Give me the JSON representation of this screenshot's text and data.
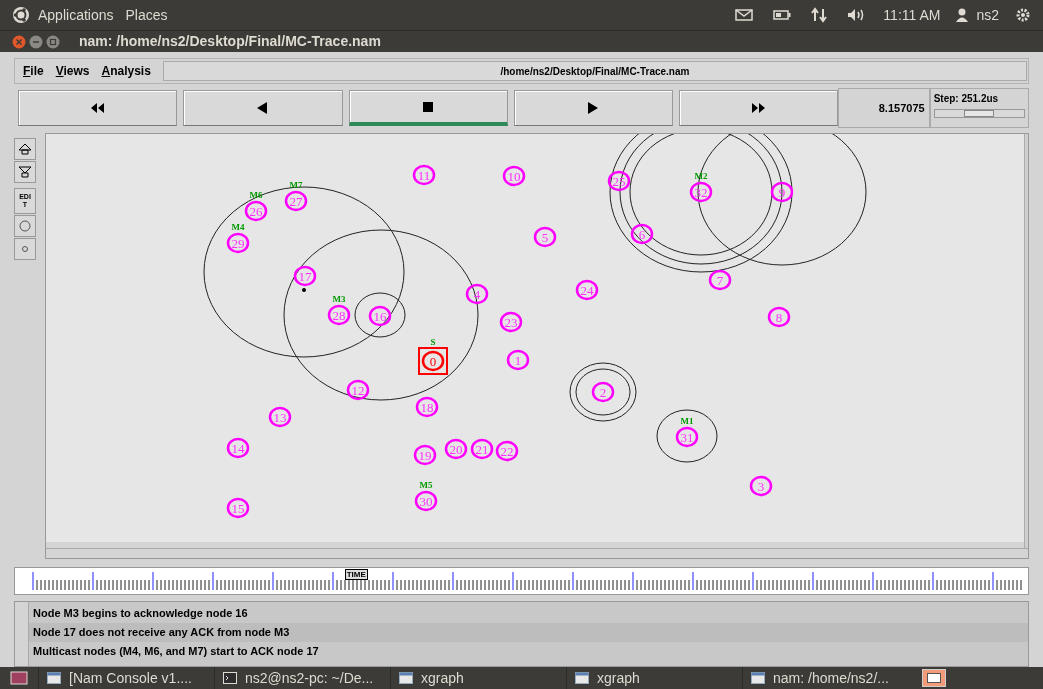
{
  "top_panel": {
    "menus": [
      "Applications",
      "Places"
    ],
    "clock": "11:11 AM",
    "user": "ns2"
  },
  "window": {
    "title": "nam: /home/ns2/Desktop/Final/MC-Trace.nam"
  },
  "menu_bar": [
    "File",
    "Views",
    "Analysis"
  ],
  "file_path": "/home/ns2/Desktop/Final/MC-Trace.nam",
  "playback_buttons": [
    {
      "kind": "fast-rewind",
      "selected": false
    },
    {
      "kind": "rewind",
      "selected": false
    },
    {
      "kind": "stop",
      "selected": true
    },
    {
      "kind": "play",
      "selected": false
    },
    {
      "kind": "fast-forward",
      "selected": false
    }
  ],
  "sim_time": "8.157075",
  "step": {
    "label": "Step: 251.2us",
    "level": 0.5
  },
  "tools": [
    {
      "kind": "zoom-in"
    },
    {
      "kind": "zoom-out"
    },
    {
      "kind": "edit",
      "label": "EDIT"
    },
    {
      "kind": "circle"
    },
    {
      "kind": "dot"
    }
  ],
  "nodes": [
    {
      "label": "26",
      "kind": "node",
      "tag": "M6"
    },
    {
      "label": "27",
      "kind": "node",
      "tag": "M7"
    },
    {
      "label": "11",
      "kind": "node"
    },
    {
      "label": "10",
      "kind": "node"
    },
    {
      "label": "25",
      "kind": "node"
    },
    {
      "label": "32",
      "kind": "node",
      "tag": "M2"
    },
    {
      "label": "9",
      "kind": "node"
    },
    {
      "label": "29",
      "kind": "node",
      "tag": "M4"
    },
    {
      "label": "5",
      "kind": "node"
    },
    {
      "label": "6",
      "kind": "node"
    },
    {
      "label": "17",
      "kind": "node"
    },
    {
      "label": "28",
      "kind": "node",
      "tag": "M3"
    },
    {
      "label": "16",
      "kind": "node"
    },
    {
      "label": "4",
      "kind": "node"
    },
    {
      "label": "23",
      "kind": "node"
    },
    {
      "label": "24",
      "kind": "node"
    },
    {
      "label": "7",
      "kind": "node"
    },
    {
      "label": "8",
      "kind": "node"
    },
    {
      "label": "0",
      "kind": "source",
      "tag": "S"
    },
    {
      "label": "1",
      "kind": "node"
    },
    {
      "label": "14",
      "kind": "node"
    },
    {
      "label": "13",
      "kind": "node"
    },
    {
      "label": "12",
      "kind": "node"
    },
    {
      "label": "18",
      "kind": "node"
    },
    {
      "label": "19",
      "kind": "node"
    },
    {
      "label": "20",
      "kind": "node"
    },
    {
      "label": "21",
      "kind": "node"
    },
    {
      "label": "22",
      "kind": "node"
    },
    {
      "label": "2",
      "kind": "node"
    },
    {
      "label": "31",
      "kind": "node",
      "tag": "M1"
    },
    {
      "label": "15",
      "kind": "node"
    },
    {
      "label": "30",
      "kind": "node",
      "tag": "M5"
    },
    {
      "label": "3",
      "kind": "node"
    }
  ],
  "timeline": {
    "marker": "TIME",
    "level": 0.34
  },
  "log": [
    "Node M3 begins to acknowledge node 16",
    "Node 17 does not receive any ACK from node M3",
    "Multicast nodes (M4, M6, and M7) start to ACK node 17"
  ],
  "taskbar": [
    {
      "label": "[Nam Console v1....",
      "kind": "window"
    },
    {
      "label": "ns2@ns2-pc: ~/De...",
      "kind": "terminal"
    },
    {
      "label": "xgraph",
      "kind": "window"
    },
    {
      "label": "xgraph",
      "kind": "window"
    },
    {
      "label": "nam: /home/ns2/...",
      "kind": "window"
    }
  ]
}
